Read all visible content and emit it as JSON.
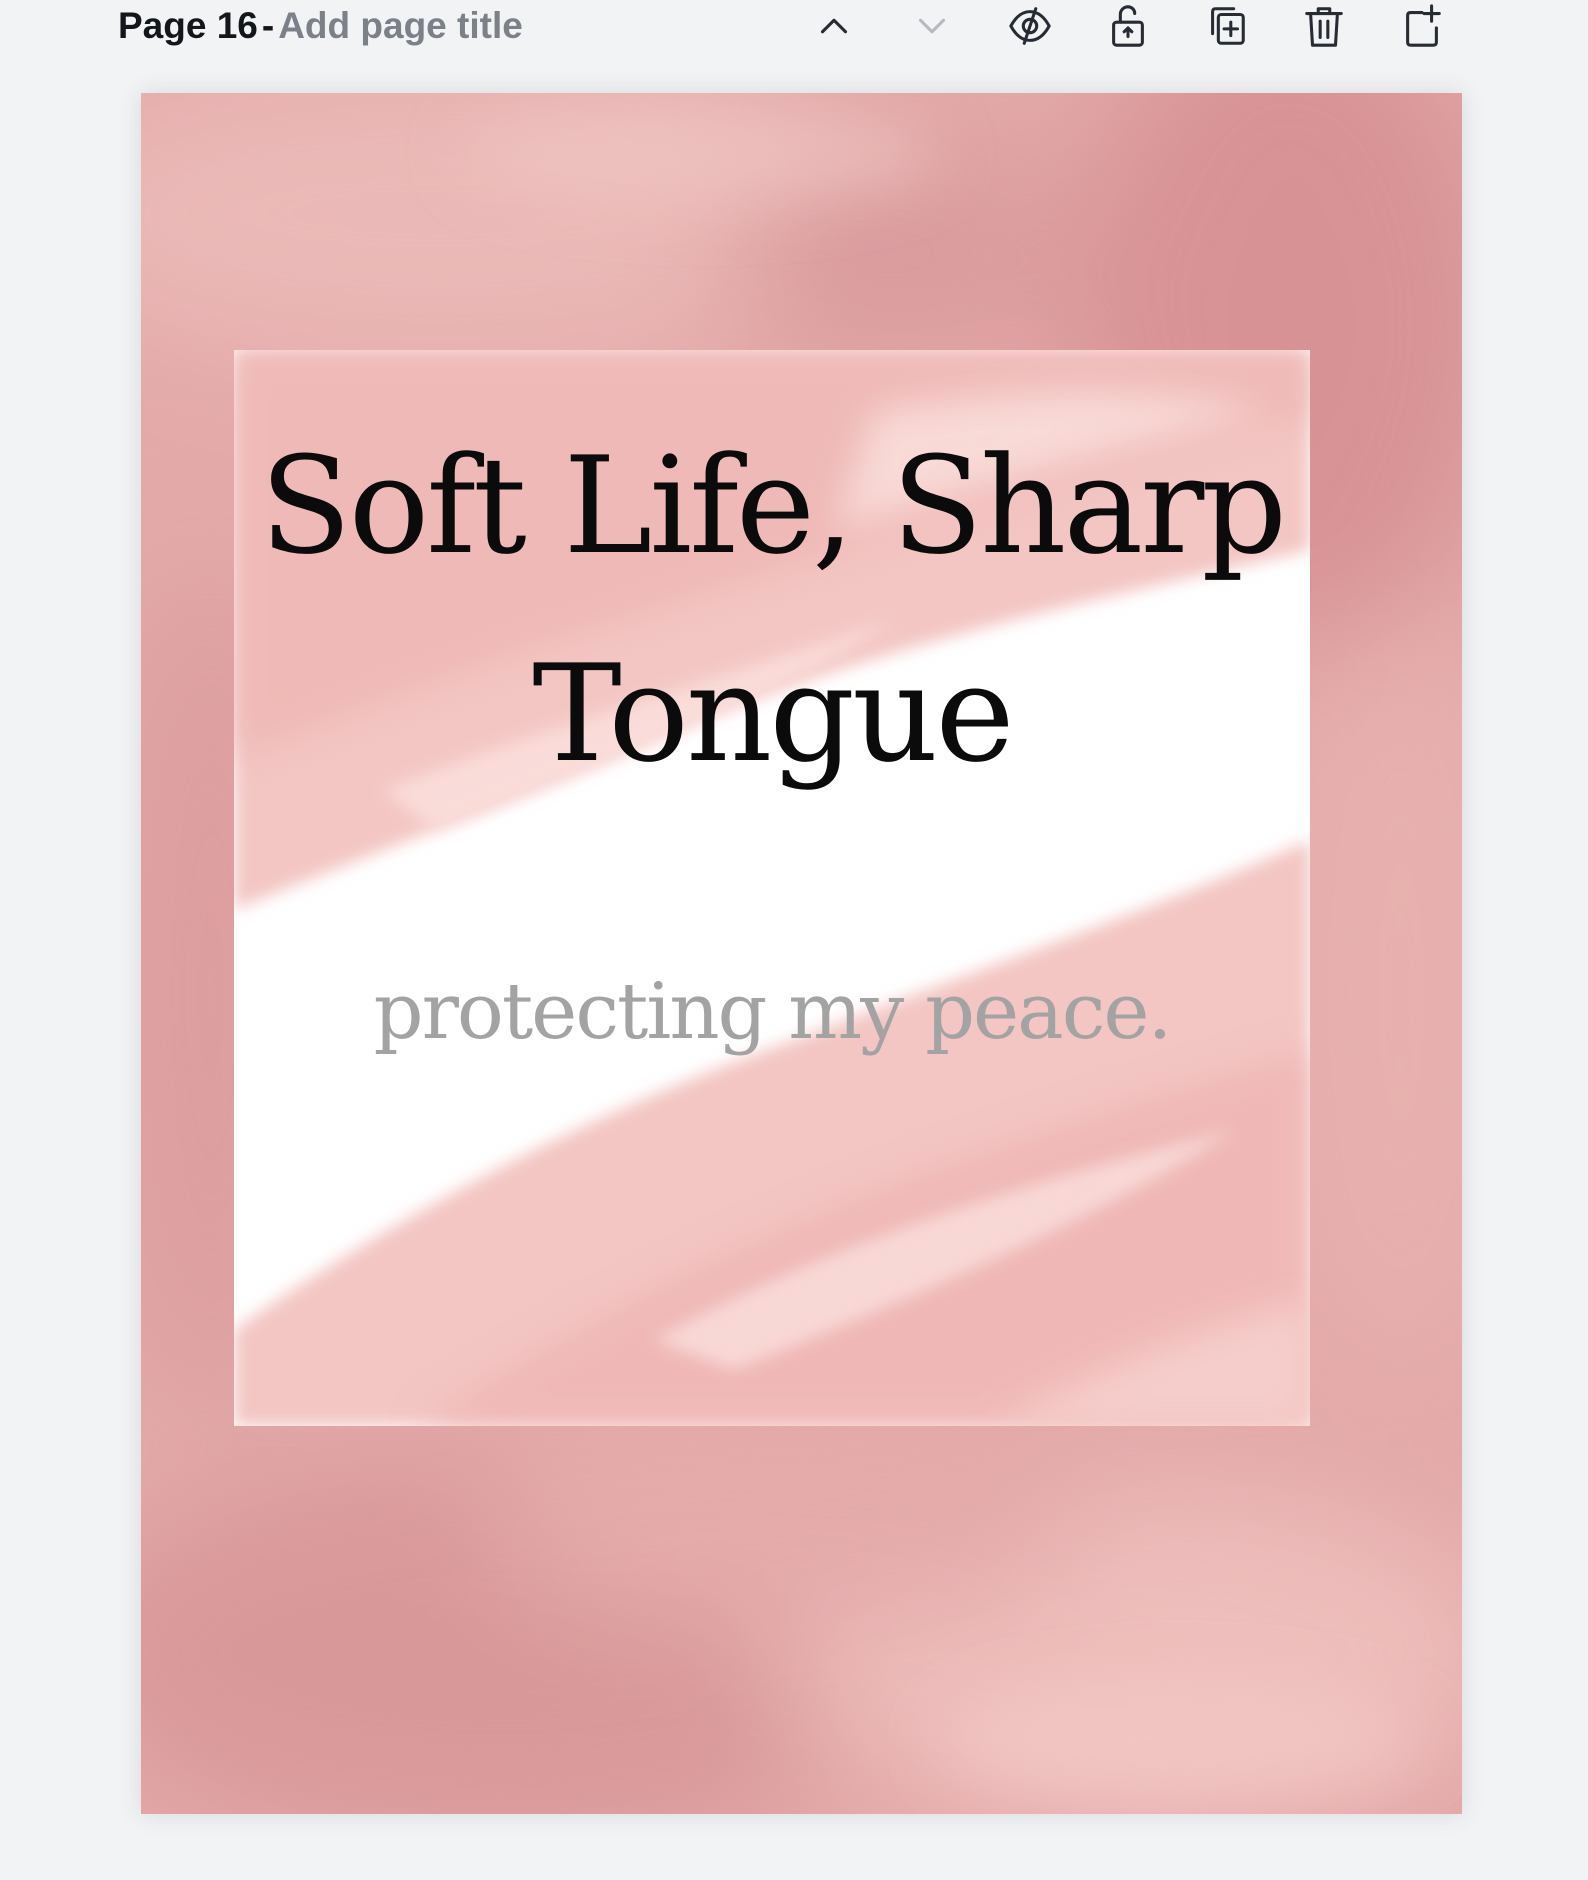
{
  "page_header": {
    "page_number": "Page 16",
    "separator": "-",
    "title_placeholder": "Add page title",
    "tools": [
      {
        "name": "move-page-up",
        "icon": "chevron-up-icon",
        "enabled": true
      },
      {
        "name": "move-page-down",
        "icon": "chevron-down-icon",
        "enabled": false
      },
      {
        "name": "hide-page",
        "icon": "eye-slash-icon",
        "enabled": true
      },
      {
        "name": "lock-page",
        "icon": "lock-open-icon",
        "enabled": true
      },
      {
        "name": "duplicate-page",
        "icon": "duplicate-icon",
        "enabled": true
      },
      {
        "name": "delete-page",
        "icon": "trash-icon",
        "enabled": true
      },
      {
        "name": "add-page",
        "icon": "add-page-icon",
        "enabled": true
      }
    ]
  },
  "design": {
    "headline": "Soft Life, Sharp Tongue",
    "tagline": "protecting my peace.",
    "colors": {
      "background_pink": "#e3a9a9",
      "watercolor_light": "#f3c9c6",
      "card": "#ffffff",
      "headline_text": "#0b0b0b",
      "tagline_text": "#a3a3a3"
    }
  }
}
